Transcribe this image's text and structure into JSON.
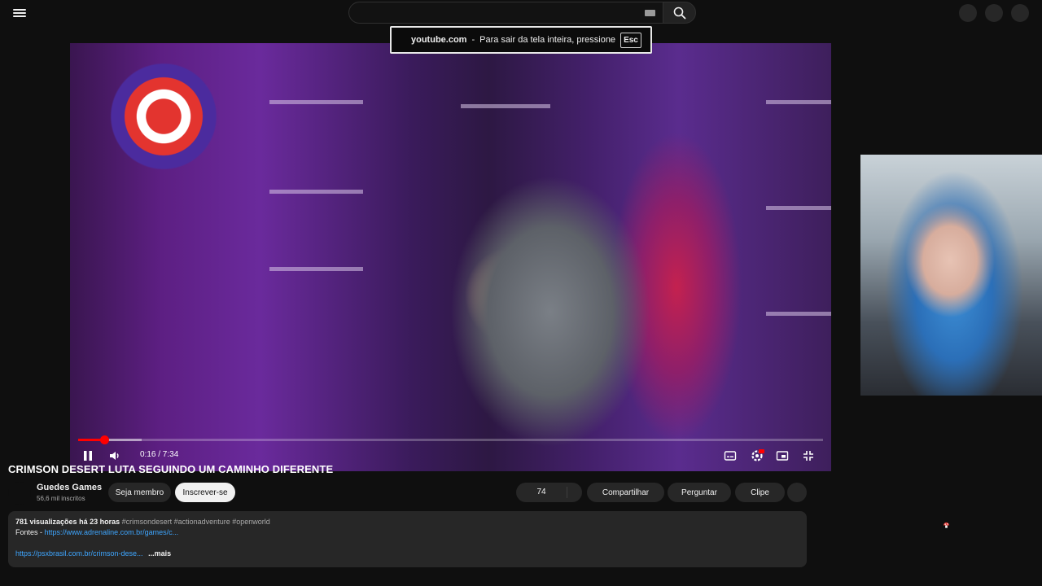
{
  "header": {
    "menu_icon": "hamburger-menu-icon",
    "search_placeholder": "",
    "keyboard_icon": "keyboard-icon",
    "search_icon": "search-icon"
  },
  "fullscreen_notice": {
    "domain": "youtube.com",
    "separator": "-",
    "message": "Para sair da tela inteira, pressione",
    "key": "Esc"
  },
  "player": {
    "current_time": "0:16",
    "duration": "7:34",
    "time_display": "0:16 / 7:34",
    "played_fraction": 0.035,
    "buffered_fraction": 0.085,
    "icons": [
      "pause-icon",
      "volume-icon",
      "captions-icon",
      "settings-icon",
      "miniplayer-icon",
      "exit-fullscreen-icon"
    ],
    "settings_badge": "HD",
    "accent_color": "#ff0000"
  },
  "video": {
    "title": "CRIMSON DESERT LUTA SEGUINDO UM CAMINHO DIFERENTE",
    "channel": "Guedes Games",
    "subscribers": "56,6 mil inscritos",
    "join_label": "Seja membro",
    "subscribe_label": "Inscrever-se",
    "likes": "74",
    "share_label": "Compartilhar",
    "ask_label": "Perguntar",
    "clip_label": "Clipe"
  },
  "description": {
    "views": "781 visualizações",
    "age": "há 23 horas",
    "hashtags": "#crimsondesert #actionadventure #openworld",
    "sources_label": "Fontes -",
    "link1": "https://www.adrenaline.com.br/games/c...",
    "link2": "https://psxbrasil.com.br/crimson-dese...",
    "more_label": "...mais"
  }
}
